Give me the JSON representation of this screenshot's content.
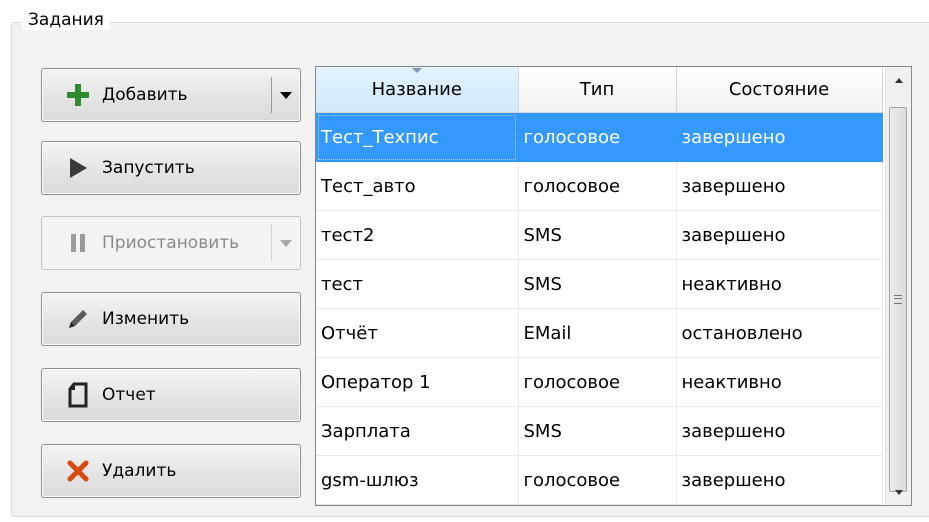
{
  "group": {
    "title": "Задания"
  },
  "buttons": {
    "add": {
      "label": "Добавить",
      "icon": "plus-icon",
      "color": "#2e8b2e"
    },
    "start": {
      "label": "Запустить",
      "icon": "play-icon"
    },
    "pause": {
      "label": "Приостановить",
      "icon": "pause-icon",
      "disabled": true
    },
    "edit": {
      "label": "Изменить",
      "icon": "pencil-icon"
    },
    "report": {
      "label": "Отчет",
      "icon": "document-icon"
    },
    "delete": {
      "label": "Удалить",
      "icon": "x-icon",
      "color": "#d9480f"
    }
  },
  "table": {
    "columns": [
      "Название",
      "Тип",
      "Состояние"
    ],
    "sorted_column": "Название",
    "selected_row": 0,
    "rows": [
      {
        "name": "Тест_Техпис",
        "type": "голосовое",
        "state": "завершено"
      },
      {
        "name": "Тест_авто",
        "type": "голосовое",
        "state": "завершено"
      },
      {
        "name": "тест2",
        "type": "SMS",
        "state": "завершено"
      },
      {
        "name": "тест",
        "type": "SMS",
        "state": "неактивно"
      },
      {
        "name": "Отчёт",
        "type": "EMail",
        "state": "остановлено"
      },
      {
        "name": "Оператор 1",
        "type": "голосовое",
        "state": "неактивно"
      },
      {
        "name": "Зарплата",
        "type": "SMS",
        "state": "завершено"
      },
      {
        "name": "gsm-шлюз",
        "type": "голосовое",
        "state": "завершено"
      }
    ]
  },
  "colors": {
    "selection": "#3399ff",
    "header_sorted": "#cfe8fa"
  }
}
